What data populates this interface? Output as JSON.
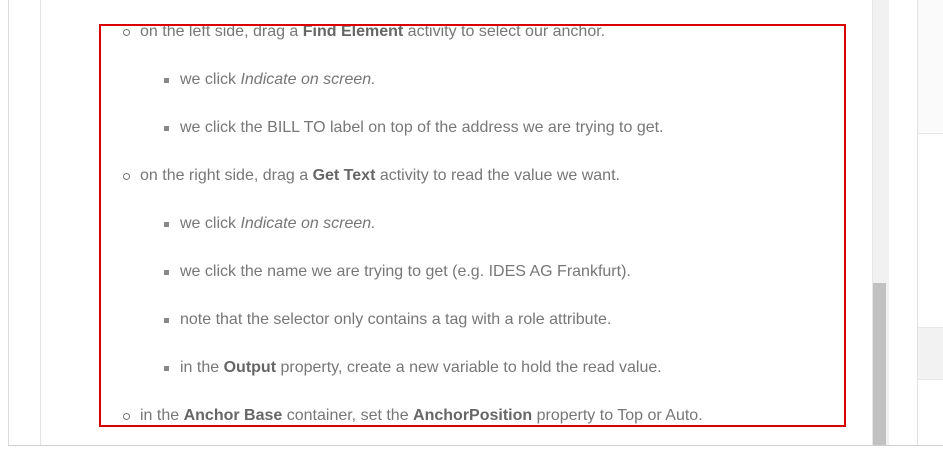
{
  "doc": {
    "items": [
      {
        "level": 1,
        "parts": [
          {
            "t": "on the left side, drag a ",
            "s": "n"
          },
          {
            "t": "Find Element",
            "s": "b"
          },
          {
            "t": " activity to select our anchor.",
            "s": "n"
          }
        ]
      },
      {
        "level": 2,
        "parts": [
          {
            "t": "we click ",
            "s": "n"
          },
          {
            "t": "Indicate on screen.",
            "s": "i"
          }
        ]
      },
      {
        "level": 2,
        "parts": [
          {
            "t": "we click the BILL TO label on top of the address we are trying to get.",
            "s": "n"
          }
        ]
      },
      {
        "level": 1,
        "parts": [
          {
            "t": "on the right side, drag a ",
            "s": "n"
          },
          {
            "t": "Get Text",
            "s": "b"
          },
          {
            "t": " activity to read the value we want.",
            "s": "n"
          }
        ]
      },
      {
        "level": 2,
        "parts": [
          {
            "t": "we click ",
            "s": "n"
          },
          {
            "t": "Indicate on screen.",
            "s": "i"
          }
        ]
      },
      {
        "level": 2,
        "parts": [
          {
            "t": "we click the name we are trying to get (e.g. IDES AG Frankfurt).",
            "s": "n"
          }
        ]
      },
      {
        "level": 2,
        "parts": [
          {
            "t": "note that the selector only contains a tag with a role attribute.",
            "s": "n"
          }
        ]
      },
      {
        "level": 2,
        "parts": [
          {
            "t": "in the ",
            "s": "n"
          },
          {
            "t": "Output",
            "s": "b"
          },
          {
            "t": " property, create a new variable to hold the read value.",
            "s": "n"
          }
        ]
      },
      {
        "level": 1,
        "parts": [
          {
            "t": "in the ",
            "s": "n"
          },
          {
            "t": "Anchor Base",
            "s": "b"
          },
          {
            "t": " container, set the ",
            "s": "n"
          },
          {
            "t": "AnchorPosition",
            "s": "b"
          },
          {
            "t": " property to Top or Auto.",
            "s": "n"
          }
        ]
      }
    ]
  },
  "colors": {
    "highlight_border": "#d90000",
    "text": "#777777",
    "scroll_thumb": "#c1c1c1"
  },
  "icons": {
    "level1_bullet": "hollow-circle-bullet-icon",
    "level2_bullet": "square-bullet-icon"
  }
}
